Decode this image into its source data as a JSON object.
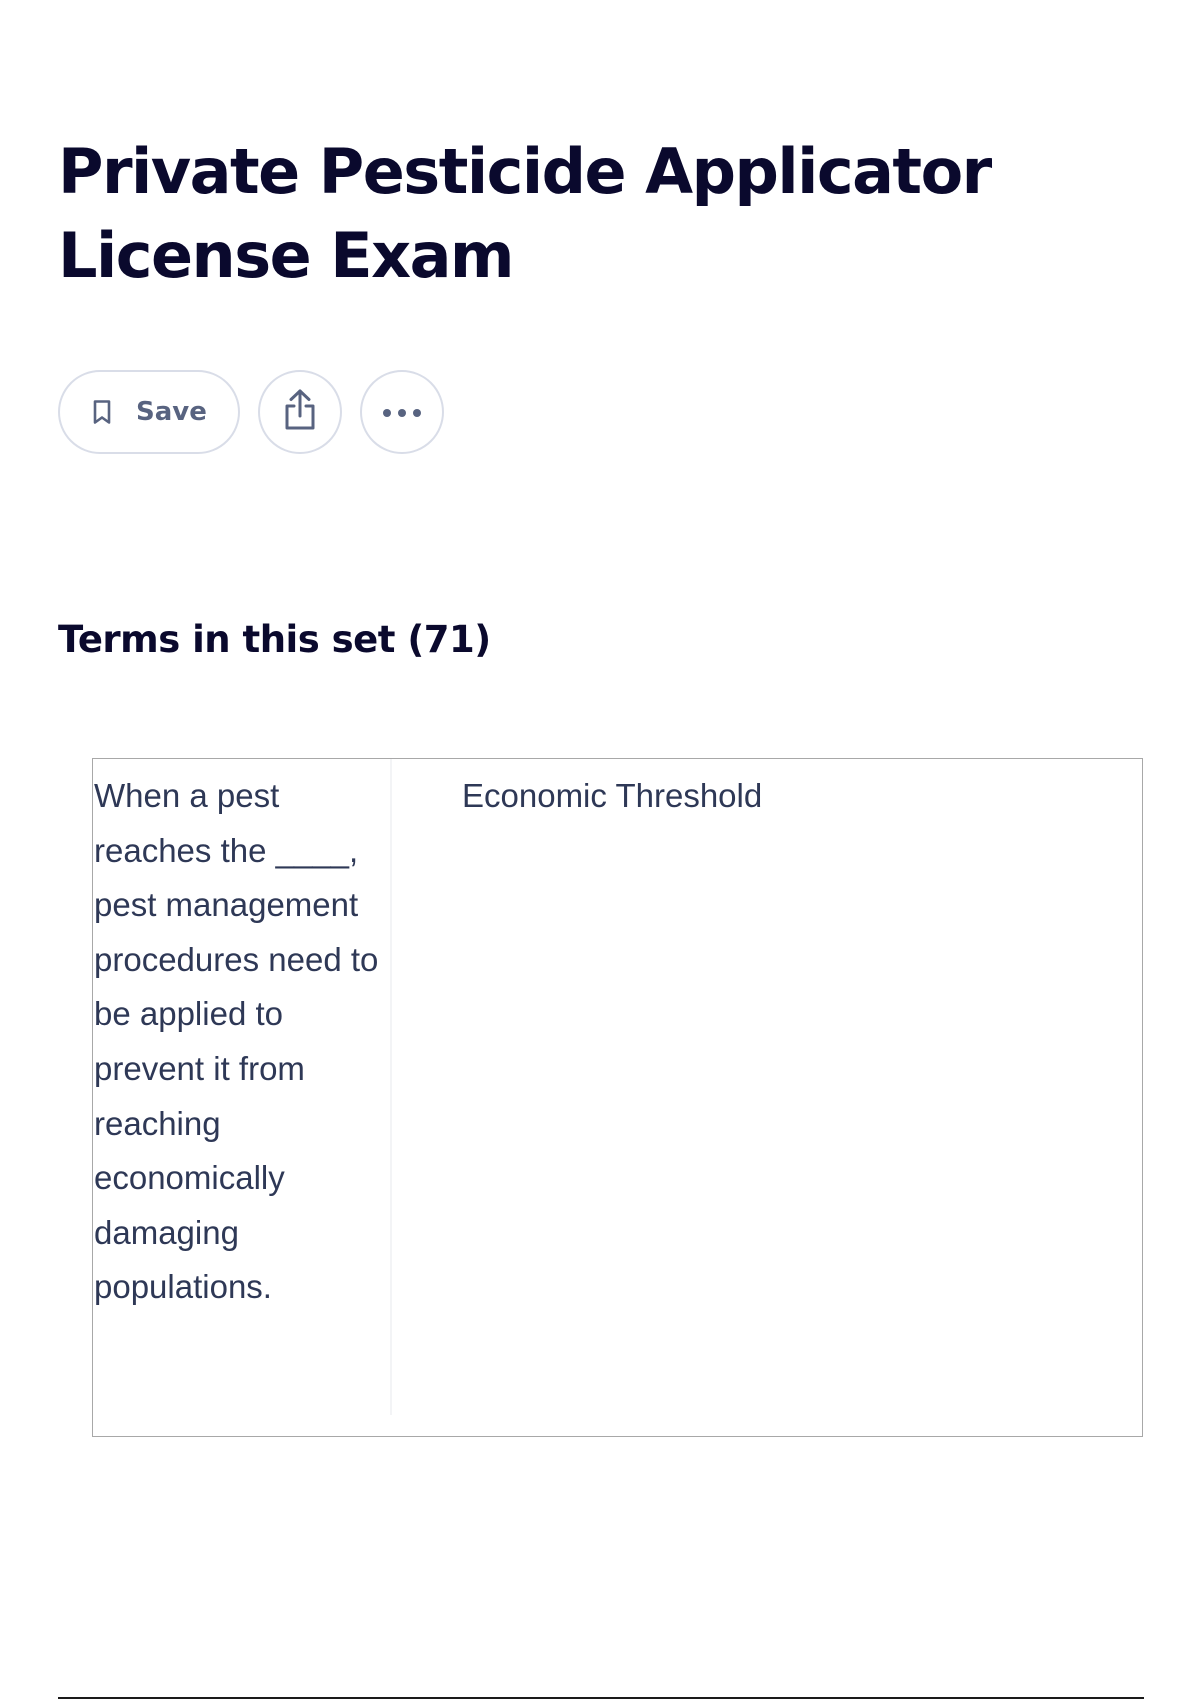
{
  "page": {
    "title": "Private Pesticide Applicator License Exam"
  },
  "actions": {
    "save_label": "Save",
    "save_icon": "bookmark-icon",
    "share_icon": "share-icon",
    "more_icon": "more-options-icon"
  },
  "terms_section": {
    "heading": "Terms in this set (71)"
  },
  "terms": [
    {
      "term": "When a pest reaches the ____, pest management procedures need to be applied to prevent it from reaching economically damaging populations.",
      "definition": "Economic Threshold"
    }
  ],
  "colors": {
    "title_text": "#0a092d",
    "button_border": "#d9dde8",
    "button_icon": "#586380",
    "card_border": "#a8a8a8",
    "body_text": "#2e3856"
  }
}
